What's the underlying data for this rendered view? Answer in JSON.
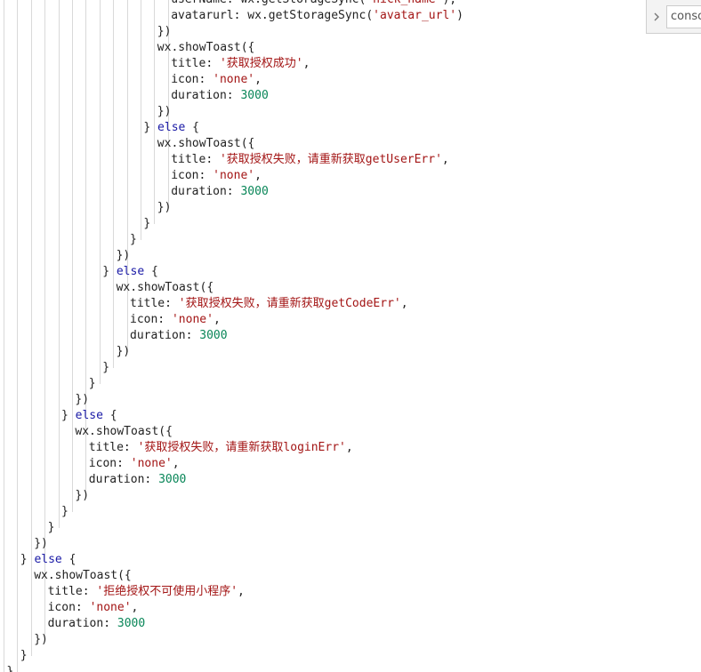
{
  "console": {
    "label": "consol",
    "icon": "chevron-right-icon"
  },
  "colors": {
    "keyword": "#1a1aa6",
    "string": "#a31515",
    "number": "#098658",
    "text": "#222222",
    "guide": "#d9d9d9"
  },
  "code_lines": [
    [
      [
        "plain",
        "userName: wx.getStorageSync("
      ],
      [
        "str",
        "'nick_name'"
      ],
      [
        "plain",
        "),"
      ]
    ],
    [
      [
        "plain",
        "avatarurl: wx.getStorageSync("
      ],
      [
        "str",
        "'avatar_url'"
      ],
      [
        "plain",
        ")"
      ]
    ],
    [
      [
        "plain",
        "})"
      ]
    ],
    [
      [
        "plain",
        "wx.showToast({"
      ]
    ],
    [
      [
        "plain",
        "title: "
      ],
      [
        "str",
        "'获取授权成功'"
      ],
      [
        "plain",
        ","
      ]
    ],
    [
      [
        "plain",
        "icon: "
      ],
      [
        "str",
        "'none'"
      ],
      [
        "plain",
        ","
      ]
    ],
    [
      [
        "plain",
        "duration: "
      ],
      [
        "num",
        "3000"
      ]
    ],
    [
      [
        "plain",
        "})"
      ]
    ],
    [
      [
        "plain",
        "} "
      ],
      [
        "kw",
        "else"
      ],
      [
        "plain",
        " {"
      ]
    ],
    [
      [
        "plain",
        "wx.showToast({"
      ]
    ],
    [
      [
        "plain",
        "title: "
      ],
      [
        "str",
        "'获取授权失败，请重新获取getUserErr'"
      ],
      [
        "plain",
        ","
      ]
    ],
    [
      [
        "plain",
        "icon: "
      ],
      [
        "str",
        "'none'"
      ],
      [
        "plain",
        ","
      ]
    ],
    [
      [
        "plain",
        "duration: "
      ],
      [
        "num",
        "3000"
      ]
    ],
    [
      [
        "plain",
        "})"
      ]
    ],
    [
      [
        "plain",
        "}"
      ]
    ],
    [
      [
        "plain",
        "}"
      ]
    ],
    [
      [
        "plain",
        "})"
      ]
    ],
    [
      [
        "plain",
        "} "
      ],
      [
        "kw",
        "else"
      ],
      [
        "plain",
        " {"
      ]
    ],
    [
      [
        "plain",
        "wx.showToast({"
      ]
    ],
    [
      [
        "plain",
        "title: "
      ],
      [
        "str",
        "'获取授权失败，请重新获取getCodeErr'"
      ],
      [
        "plain",
        ","
      ]
    ],
    [
      [
        "plain",
        "icon: "
      ],
      [
        "str",
        "'none'"
      ],
      [
        "plain",
        ","
      ]
    ],
    [
      [
        "plain",
        "duration: "
      ],
      [
        "num",
        "3000"
      ]
    ],
    [
      [
        "plain",
        "})"
      ]
    ],
    [
      [
        "plain",
        "}"
      ]
    ],
    [
      [
        "plain",
        "}"
      ]
    ],
    [
      [
        "plain",
        "})"
      ]
    ],
    [
      [
        "plain",
        "} "
      ],
      [
        "kw",
        "else"
      ],
      [
        "plain",
        " {"
      ]
    ],
    [
      [
        "plain",
        "wx.showToast({"
      ]
    ],
    [
      [
        "plain",
        "title: "
      ],
      [
        "str",
        "'获取授权失败，请重新获取loginErr'"
      ],
      [
        "plain",
        ","
      ]
    ],
    [
      [
        "plain",
        "icon: "
      ],
      [
        "str",
        "'none'"
      ],
      [
        "plain",
        ","
      ]
    ],
    [
      [
        "plain",
        "duration: "
      ],
      [
        "num",
        "3000"
      ]
    ],
    [
      [
        "plain",
        "})"
      ]
    ],
    [
      [
        "plain",
        "}"
      ]
    ],
    [
      [
        "plain",
        "}"
      ]
    ],
    [
      [
        "plain",
        "})"
      ]
    ],
    [
      [
        "plain",
        "} "
      ],
      [
        "kw",
        "else"
      ],
      [
        "plain",
        " {"
      ]
    ],
    [
      [
        "plain",
        "wx.showToast({"
      ]
    ],
    [
      [
        "plain",
        "title: "
      ],
      [
        "str",
        "'拒绝授权不可使用小程序'"
      ],
      [
        "plain",
        ","
      ]
    ],
    [
      [
        "plain",
        "icon: "
      ],
      [
        "str",
        "'none'"
      ],
      [
        "plain",
        ","
      ]
    ],
    [
      [
        "plain",
        "duration: "
      ],
      [
        "num",
        "3000"
      ]
    ],
    [
      [
        "plain",
        "})"
      ]
    ],
    [
      [
        "plain",
        "}"
      ]
    ],
    [
      [
        "plain",
        "}"
      ]
    ]
  ]
}
